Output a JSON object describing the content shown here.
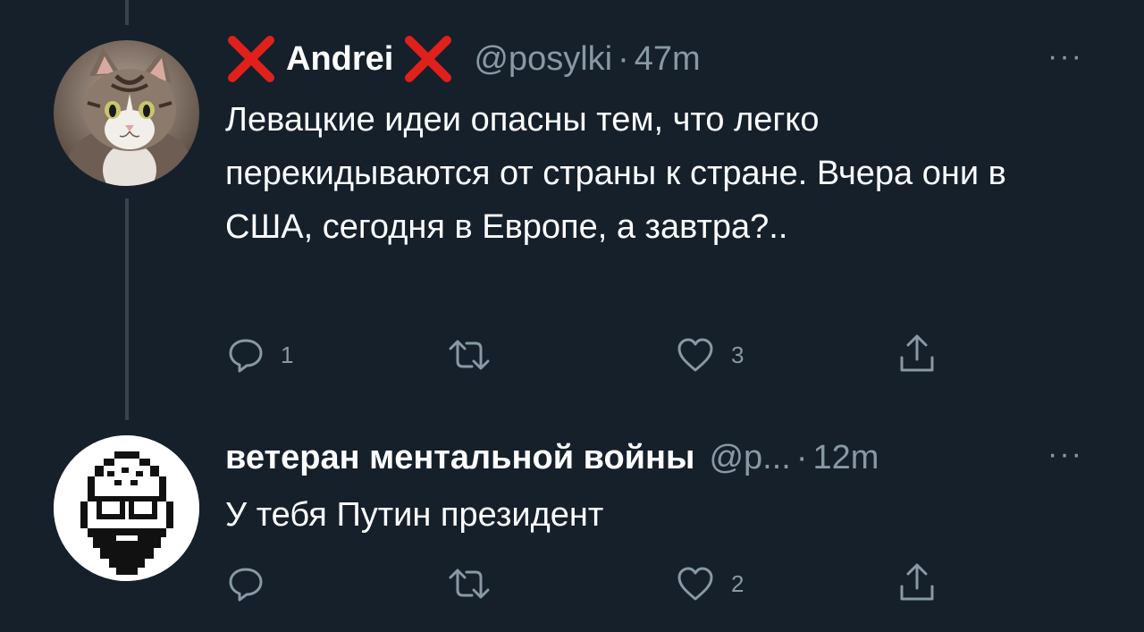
{
  "tweets": [
    {
      "display_name": "Andrei",
      "handle": "@posylki",
      "separator": "·",
      "time": "47m",
      "more_label": "···",
      "text": "Левацкие идеи опасны тем, что легко перекидываются от страны к стране. Вчера они в США, сегодня в Европе, а завтра?..",
      "actions": {
        "reply_count": "1",
        "retweet_count": "",
        "like_count": "3"
      },
      "avatar_icon": "cat-photo",
      "name_decoration_icon": "red-x-icon"
    },
    {
      "display_name": "ветеран ментальной войны",
      "handle": "@p...",
      "separator": "·",
      "time": "12m",
      "more_label": "···",
      "text": "У тебя Путин президент",
      "actions": {
        "reply_count": "",
        "retweet_count": "",
        "like_count": "2"
      },
      "avatar_icon": "pixel-bearded-man"
    }
  ],
  "colors": {
    "background": "#15202b",
    "text": "#ffffff",
    "muted": "#8899a6",
    "x_mark": "#e0211b",
    "thread_line": "#38444d"
  }
}
